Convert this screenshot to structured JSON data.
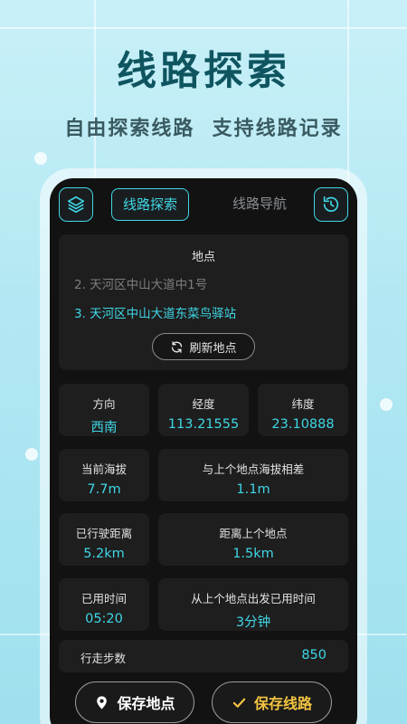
{
  "hero": {
    "title": "线路探索",
    "subtitle": "自由探索线路  支持线路记录"
  },
  "topbar": {
    "left_icon": "layers-icon",
    "right_icon": "history-icon",
    "tabs": [
      {
        "label": "线路探索",
        "active": true
      },
      {
        "label": "线路导航",
        "active": false
      }
    ]
  },
  "location": {
    "title": "地点",
    "items": [
      {
        "text": "2. 天河区中山大道中1号"
      },
      {
        "text": "3. 天河区中山大道东菜鸟驿站"
      }
    ],
    "refresh_label": "刷新地点"
  },
  "stats": {
    "direction": {
      "label": "方向",
      "value": "西南"
    },
    "longitude": {
      "label": "经度",
      "value": "113.21555"
    },
    "latitude": {
      "label": "纬度",
      "value": "23.10888"
    },
    "altitude": {
      "label": "当前海拔",
      "value": "7.7m"
    },
    "altitude_diff": {
      "label": "与上个地点海拔相差",
      "value": "1.1m"
    },
    "distance": {
      "label": "已行驶距离",
      "value": "5.2km"
    },
    "distance_prev": {
      "label": "距离上个地点",
      "value": "1.5km"
    },
    "time_used": {
      "label": "已用时间",
      "value": "05:20"
    },
    "time_prev": {
      "label": "从上个地点出发已用时间",
      "value": "3分钟"
    },
    "steps": {
      "label": "行走步数",
      "value": "850"
    }
  },
  "actions": {
    "save_location": "保存地点",
    "save_route": "保存线路"
  },
  "colors": {
    "accent": "#3fd7e6",
    "gold": "#f4c542",
    "background": "#121212",
    "card": "#1e1e1e"
  }
}
